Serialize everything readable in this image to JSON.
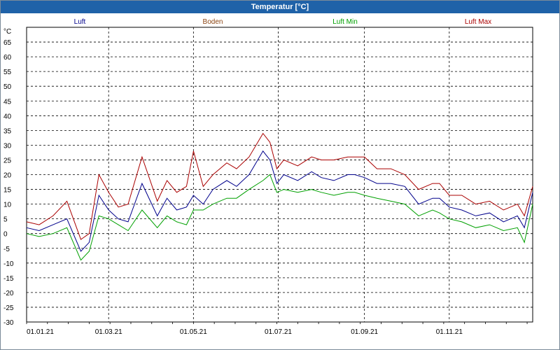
{
  "window": {
    "title": "Temperatur [°C]"
  },
  "chart_data": {
    "type": "line",
    "title": "Temperatur [°C]",
    "ylabel": "°C",
    "xlabel": "",
    "ylim": [
      -30,
      70
    ],
    "yticks": [
      -30,
      -25,
      -20,
      -15,
      -10,
      -5,
      0,
      5,
      10,
      15,
      20,
      25,
      30,
      35,
      40,
      45,
      50,
      55,
      60,
      65
    ],
    "xlim": [
      "2021-01-01",
      "2021-12-31"
    ],
    "xticks": [
      {
        "date": "2021-01-01",
        "label": "01.01.21"
      },
      {
        "date": "2021-03-01",
        "label": "01.03.21"
      },
      {
        "date": "2021-05-01",
        "label": "01.05.21"
      },
      {
        "date": "2021-07-01",
        "label": "01.07.21"
      },
      {
        "date": "2021-09-01",
        "label": "01.09.21"
      },
      {
        "date": "2021-11-01",
        "label": "01.11.21"
      }
    ],
    "grid": true,
    "legend_position": "top",
    "x_dates": [
      "2021-01-01",
      "2021-01-10",
      "2021-01-20",
      "2021-01-30",
      "2021-02-09",
      "2021-02-15",
      "2021-02-22",
      "2021-03-01",
      "2021-03-08",
      "2021-03-15",
      "2021-03-25",
      "2021-04-05",
      "2021-04-12",
      "2021-04-19",
      "2021-04-26",
      "2021-05-01",
      "2021-05-08",
      "2021-05-15",
      "2021-05-25",
      "2021-06-01",
      "2021-06-10",
      "2021-06-20",
      "2021-06-25",
      "2021-06-30",
      "2021-07-05",
      "2021-07-15",
      "2021-07-25",
      "2021-08-01",
      "2021-08-10",
      "2021-08-20",
      "2021-08-25",
      "2021-09-01",
      "2021-09-10",
      "2021-09-20",
      "2021-09-30",
      "2021-10-10",
      "2021-10-20",
      "2021-10-25",
      "2021-11-01",
      "2021-11-10",
      "2021-11-20",
      "2021-11-30",
      "2021-12-10",
      "2021-12-20",
      "2021-12-25",
      "2021-12-31"
    ],
    "series": [
      {
        "name": "Luft",
        "color": "#00008b",
        "values": [
          2,
          1,
          3,
          5,
          -6,
          -3,
          13,
          8,
          5,
          4,
          17,
          6,
          12,
          8,
          9,
          13,
          10,
          15,
          18,
          16,
          20,
          28,
          25,
          17,
          20,
          18,
          21,
          19,
          18,
          20,
          20,
          19,
          17,
          17,
          16,
          10,
          12,
          12,
          9,
          8,
          6,
          7,
          4,
          6,
          2,
          14
        ]
      },
      {
        "name": "Boden",
        "color": "#8b4513",
        "values": []
      },
      {
        "name": "Luft Min",
        "color": "#00a000",
        "values": [
          0,
          -1,
          0,
          2,
          -9,
          -6,
          6,
          5,
          3,
          1,
          8,
          2,
          6,
          4,
          3,
          8,
          8,
          10,
          12,
          12,
          15,
          18,
          20,
          14,
          15,
          14,
          15,
          14,
          13,
          14,
          14,
          13,
          12,
          11,
          10,
          6,
          8,
          7,
          5,
          4,
          2,
          3,
          1,
          2,
          -3,
          10
        ]
      },
      {
        "name": "Luft Max",
        "color": "#aa0000",
        "values": [
          4,
          3,
          6,
          11,
          -2,
          0,
          20,
          14,
          9,
          10,
          26,
          11,
          18,
          14,
          16,
          28,
          16,
          20,
          24,
          22,
          26,
          34,
          31,
          22,
          25,
          23,
          26,
          25,
          25,
          26,
          26,
          26,
          22,
          22,
          20,
          15,
          17,
          17,
          13,
          13,
          10,
          11,
          8,
          10,
          6,
          16
        ]
      }
    ]
  }
}
